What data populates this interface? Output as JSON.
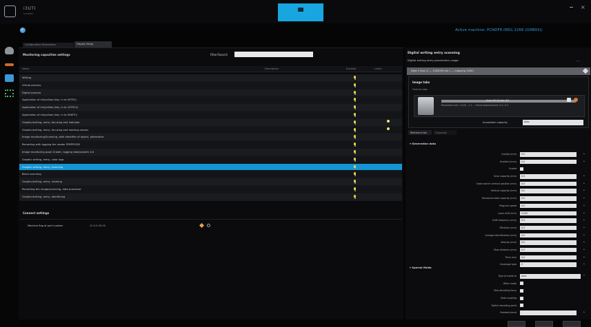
{
  "window": {
    "logo_text": "i3UTI",
    "logo_sub": "SYSTEMS",
    "minimize": "–",
    "close": "×"
  },
  "header": {
    "active_machine": "Active machine: PCNDF8 (REG 2268 (GHB93))"
  },
  "tabs": [
    {
      "label": "Configuration Parameters"
    },
    {
      "label": "Display Setup"
    }
  ],
  "main": {
    "title": "Monitoring capacities settings",
    "filter_label": "Filter/Search",
    "filter_value": "",
    "columns": [
      "Name",
      "Description",
      "Enabled",
      "Limits"
    ],
    "rows": [
      {
        "label": "Writing",
        "bulb": true,
        "limit_bulb": false,
        "selected": false
      },
      {
        "label": "Virtual process",
        "bulb": true,
        "limit_bulb": false,
        "selected": false
      },
      {
        "label": "Digital process",
        "bulb": true,
        "limit_bulb": false,
        "selected": false
      },
      {
        "label": "Application of ink/yellow (key, in to 00TR1)",
        "bulb": true,
        "limit_bulb": false,
        "selected": false
      },
      {
        "label": "Application of ink/yellow (key, in to 10TR12)",
        "bulb": true,
        "limit_bulb": false,
        "selected": false
      },
      {
        "label": "Application of ink/yellow (key, in to 00WTC)",
        "bulb": true,
        "limit_bulb": false,
        "selected": false
      },
      {
        "label": "Graphic/writing, entry, focusing and indicator",
        "bulb": true,
        "limit_bulb": true,
        "selected": false
      },
      {
        "label": "Graphic/writing, entry, focusing and marking sensor",
        "bulb": true,
        "limit_bulb": true,
        "selected": false
      },
      {
        "label": "Image monitoring/Scanning, with identifier of object, alternative",
        "bulb": true,
        "limit_bulb": false,
        "selected": false
      },
      {
        "label": "Recording with logging the reader PREPROD5",
        "bulb": true,
        "limit_bulb": false,
        "selected": false
      },
      {
        "label": "Image monitoring pool/ Grader, logging data/system 1/4",
        "bulb": true,
        "limit_bulb": false,
        "selected": false
      },
      {
        "label": "Graphic writing, entry, color logs",
        "bulb": true,
        "limit_bulb": false,
        "selected": false
      },
      {
        "label": "Graphic writing, entry, scanning",
        "bulb": true,
        "limit_bulb": false,
        "selected": true
      },
      {
        "label": "Block scanning",
        "bulb": true,
        "limit_bulb": false,
        "selected": false
      },
      {
        "label": "Graphic/writing, entry, marking",
        "bulb": true,
        "limit_bulb": false,
        "selected": false
      },
      {
        "label": "Recording the image/scanning, data processor",
        "bulb": true,
        "limit_bulb": false,
        "selected": false
      },
      {
        "label": "Graphic/writing, entry, identifying",
        "bulb": true,
        "limit_bulb": false,
        "selected": false
      }
    ],
    "connection": {
      "title": "Connect settings",
      "label": "Machine flag of port number",
      "value": "10.0.0.00:00"
    }
  },
  "right": {
    "title": "Digital writing entry scanning",
    "subtitle": "Digital writing entry parameters usage",
    "arrows": "‹ ›",
    "header": "Data 1 flow (1 — 1000000 pts 1 — mapping 1000)",
    "image_section": {
      "title": "Image tabs",
      "subtitle": "Feature tabs",
      "name": "Axis 00 Grade 40",
      "meta": "Resolution size: 1.0/10 - 1.1 — Frame displacement: 0.0 / 0.0",
      "caption_label": "Annotation capacity",
      "caption_value": "Auto"
    },
    "subtabs": [
      "Reference tab",
      "Grayscale"
    ],
    "general_title": "Generation data",
    "properties": [
      {
        "label": "Quality (mm)",
        "type": "input",
        "value": "0.0"
      },
      {
        "label": "Gradient (mm)",
        "type": "input",
        "value": "0.0"
      },
      {
        "label": "Scaled",
        "type": "check",
        "value": ""
      },
      {
        "label": "Scan capacity (mm)",
        "type": "input",
        "value": "0.0"
      },
      {
        "label": "Scale search vertical position (mm)",
        "type": "input",
        "value": "0.0"
      },
      {
        "label": "Vertical capacity (mm)",
        "type": "input",
        "value": "0.0"
      },
      {
        "label": "Horizontal data capacity (mm)",
        "type": "input",
        "value": "0.0"
      },
      {
        "label": "Program speed",
        "type": "input",
        "value": "0.0"
      },
      {
        "label": "Laser drift (mm)",
        "type": "input",
        "value": "0.000"
      },
      {
        "label": "Drift frequency (mm)",
        "type": "input",
        "value": "0.0"
      },
      {
        "label": "Filtration (mm)",
        "type": "input",
        "value": "0.0"
      },
      {
        "label": "Linkage identification (mm)",
        "type": "input",
        "value": "0.0"
      },
      {
        "label": "Velocity (mm)",
        "type": "input",
        "value": "0.0"
      },
      {
        "label": "Step divisions (mm)",
        "type": "input",
        "value": "0.0"
      },
      {
        "label": "Time (ms)",
        "type": "input",
        "value": "0.0"
      },
      {
        "label": "Coverage type",
        "type": "input",
        "value": "0"
      }
    ],
    "special_title": "Special fields",
    "special": [
      {
        "label": "Type of mode to",
        "type": "select",
        "value": "Auto"
      },
      {
        "label": "Write mode",
        "type": "check",
        "value": ""
      },
      {
        "label": "Skip decoding focus",
        "type": "check",
        "value": ""
      },
      {
        "label": "Data coupling",
        "type": "check",
        "value": ""
      },
      {
        "label": "Switch decoding point",
        "type": "check",
        "value": ""
      },
      {
        "label": "Number/count",
        "type": "input",
        "value": ""
      }
    ]
  },
  "colors": {
    "accent": "#17a6e0",
    "selected_row": "#1596d4",
    "bulb": "#e2cf4a",
    "active_text": "#2e9ad6"
  }
}
